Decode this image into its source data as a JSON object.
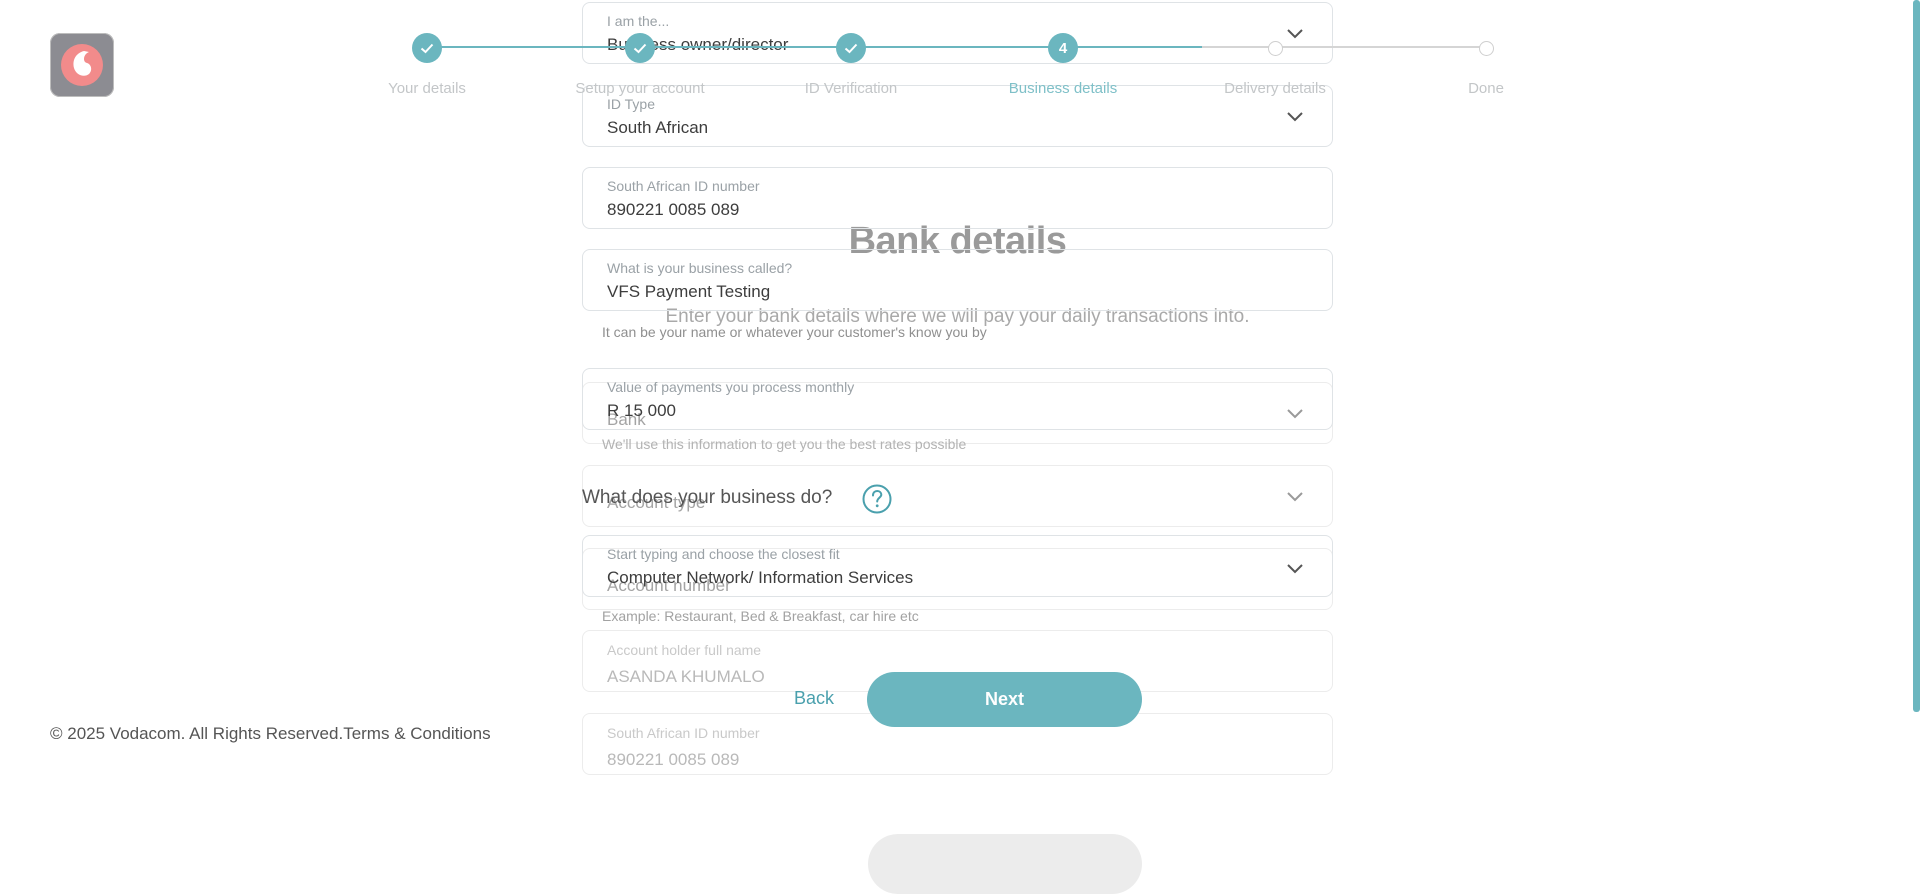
{
  "brand": {
    "logo_icon": "vodacom-logo-icon",
    "accent_color": "#6bb6bf"
  },
  "stepper": {
    "steps": [
      {
        "label": "Your details",
        "state": "done",
        "icon": "check-icon"
      },
      {
        "label": "Setup your account",
        "state": "done",
        "icon": "check-icon"
      },
      {
        "label": "ID Verification",
        "state": "done",
        "icon": "check-icon"
      },
      {
        "label": "Business details",
        "state": "active",
        "number": "4"
      },
      {
        "label": "Delivery details",
        "state": "todo"
      },
      {
        "label": "Done",
        "state": "todo"
      }
    ]
  },
  "bank": {
    "title": "Bank details",
    "subtitle": "Enter your bank details where we will pay your daily transactions into.",
    "bank_placeholder": "Bank",
    "account_type_placeholder": "Account type",
    "account_number_placeholder": "Account number",
    "holder_label": "Account holder full name",
    "holder_value": "ASANDA KHUMALO",
    "id_label": "South African ID number",
    "id_value": "890221 0085 089"
  },
  "business": {
    "role": {
      "label": "I am the...",
      "value": "Business owner/director"
    },
    "id_type": {
      "label": "ID Type",
      "value": "South African"
    },
    "id_number": {
      "label": "South African ID number",
      "value": "890221 0085 089"
    },
    "name": {
      "label": "What is your business called?",
      "value": "VFS Payment Testing",
      "hint": "It can be your name or whatever your customer's know you by"
    },
    "payments": {
      "label": "Value of payments you process monthly",
      "value": "R 15 000",
      "hint": "We'll use this information to get you the best rates possible"
    },
    "question": "What does your business do?",
    "industry": {
      "label": "Start typing and choose the closest fit",
      "value": "Computer Network/ Information Services",
      "hint": "Example: Restaurant, Bed & Breakfast, car hire etc"
    }
  },
  "actions": {
    "back_label": "Back",
    "next_label": "Next"
  },
  "footer": {
    "copyright": "© 2025 Vodacom. All Rights Reserved.",
    "terms_label": "Terms & Conditions"
  }
}
